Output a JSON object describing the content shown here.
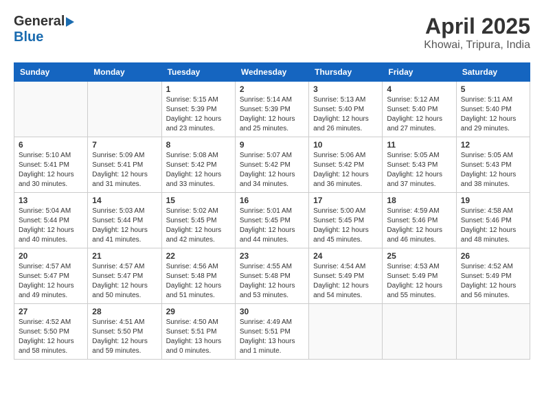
{
  "logo": {
    "general": "General",
    "blue": "Blue"
  },
  "title": "April 2025",
  "location": "Khowai, Tripura, India",
  "weekdays": [
    "Sunday",
    "Monday",
    "Tuesday",
    "Wednesday",
    "Thursday",
    "Friday",
    "Saturday"
  ],
  "days": [
    {
      "num": "",
      "sunrise": "",
      "sunset": "",
      "daylight": ""
    },
    {
      "num": "",
      "sunrise": "",
      "sunset": "",
      "daylight": ""
    },
    {
      "num": "1",
      "sunrise": "Sunrise: 5:15 AM",
      "sunset": "Sunset: 5:39 PM",
      "daylight": "Daylight: 12 hours and 23 minutes."
    },
    {
      "num": "2",
      "sunrise": "Sunrise: 5:14 AM",
      "sunset": "Sunset: 5:39 PM",
      "daylight": "Daylight: 12 hours and 25 minutes."
    },
    {
      "num": "3",
      "sunrise": "Sunrise: 5:13 AM",
      "sunset": "Sunset: 5:40 PM",
      "daylight": "Daylight: 12 hours and 26 minutes."
    },
    {
      "num": "4",
      "sunrise": "Sunrise: 5:12 AM",
      "sunset": "Sunset: 5:40 PM",
      "daylight": "Daylight: 12 hours and 27 minutes."
    },
    {
      "num": "5",
      "sunrise": "Sunrise: 5:11 AM",
      "sunset": "Sunset: 5:40 PM",
      "daylight": "Daylight: 12 hours and 29 minutes."
    },
    {
      "num": "6",
      "sunrise": "Sunrise: 5:10 AM",
      "sunset": "Sunset: 5:41 PM",
      "daylight": "Daylight: 12 hours and 30 minutes."
    },
    {
      "num": "7",
      "sunrise": "Sunrise: 5:09 AM",
      "sunset": "Sunset: 5:41 PM",
      "daylight": "Daylight: 12 hours and 31 minutes."
    },
    {
      "num": "8",
      "sunrise": "Sunrise: 5:08 AM",
      "sunset": "Sunset: 5:42 PM",
      "daylight": "Daylight: 12 hours and 33 minutes."
    },
    {
      "num": "9",
      "sunrise": "Sunrise: 5:07 AM",
      "sunset": "Sunset: 5:42 PM",
      "daylight": "Daylight: 12 hours and 34 minutes."
    },
    {
      "num": "10",
      "sunrise": "Sunrise: 5:06 AM",
      "sunset": "Sunset: 5:42 PM",
      "daylight": "Daylight: 12 hours and 36 minutes."
    },
    {
      "num": "11",
      "sunrise": "Sunrise: 5:05 AM",
      "sunset": "Sunset: 5:43 PM",
      "daylight": "Daylight: 12 hours and 37 minutes."
    },
    {
      "num": "12",
      "sunrise": "Sunrise: 5:05 AM",
      "sunset": "Sunset: 5:43 PM",
      "daylight": "Daylight: 12 hours and 38 minutes."
    },
    {
      "num": "13",
      "sunrise": "Sunrise: 5:04 AM",
      "sunset": "Sunset: 5:44 PM",
      "daylight": "Daylight: 12 hours and 40 minutes."
    },
    {
      "num": "14",
      "sunrise": "Sunrise: 5:03 AM",
      "sunset": "Sunset: 5:44 PM",
      "daylight": "Daylight: 12 hours and 41 minutes."
    },
    {
      "num": "15",
      "sunrise": "Sunrise: 5:02 AM",
      "sunset": "Sunset: 5:45 PM",
      "daylight": "Daylight: 12 hours and 42 minutes."
    },
    {
      "num": "16",
      "sunrise": "Sunrise: 5:01 AM",
      "sunset": "Sunset: 5:45 PM",
      "daylight": "Daylight: 12 hours and 44 minutes."
    },
    {
      "num": "17",
      "sunrise": "Sunrise: 5:00 AM",
      "sunset": "Sunset: 5:45 PM",
      "daylight": "Daylight: 12 hours and 45 minutes."
    },
    {
      "num": "18",
      "sunrise": "Sunrise: 4:59 AM",
      "sunset": "Sunset: 5:46 PM",
      "daylight": "Daylight: 12 hours and 46 minutes."
    },
    {
      "num": "19",
      "sunrise": "Sunrise: 4:58 AM",
      "sunset": "Sunset: 5:46 PM",
      "daylight": "Daylight: 12 hours and 48 minutes."
    },
    {
      "num": "20",
      "sunrise": "Sunrise: 4:57 AM",
      "sunset": "Sunset: 5:47 PM",
      "daylight": "Daylight: 12 hours and 49 minutes."
    },
    {
      "num": "21",
      "sunrise": "Sunrise: 4:57 AM",
      "sunset": "Sunset: 5:47 PM",
      "daylight": "Daylight: 12 hours and 50 minutes."
    },
    {
      "num": "22",
      "sunrise": "Sunrise: 4:56 AM",
      "sunset": "Sunset: 5:48 PM",
      "daylight": "Daylight: 12 hours and 51 minutes."
    },
    {
      "num": "23",
      "sunrise": "Sunrise: 4:55 AM",
      "sunset": "Sunset: 5:48 PM",
      "daylight": "Daylight: 12 hours and 53 minutes."
    },
    {
      "num": "24",
      "sunrise": "Sunrise: 4:54 AM",
      "sunset": "Sunset: 5:49 PM",
      "daylight": "Daylight: 12 hours and 54 minutes."
    },
    {
      "num": "25",
      "sunrise": "Sunrise: 4:53 AM",
      "sunset": "Sunset: 5:49 PM",
      "daylight": "Daylight: 12 hours and 55 minutes."
    },
    {
      "num": "26",
      "sunrise": "Sunrise: 4:52 AM",
      "sunset": "Sunset: 5:49 PM",
      "daylight": "Daylight: 12 hours and 56 minutes."
    },
    {
      "num": "27",
      "sunrise": "Sunrise: 4:52 AM",
      "sunset": "Sunset: 5:50 PM",
      "daylight": "Daylight: 12 hours and 58 minutes."
    },
    {
      "num": "28",
      "sunrise": "Sunrise: 4:51 AM",
      "sunset": "Sunset: 5:50 PM",
      "daylight": "Daylight: 12 hours and 59 minutes."
    },
    {
      "num": "29",
      "sunrise": "Sunrise: 4:50 AM",
      "sunset": "Sunset: 5:51 PM",
      "daylight": "Daylight: 13 hours and 0 minutes."
    },
    {
      "num": "30",
      "sunrise": "Sunrise: 4:49 AM",
      "sunset": "Sunset: 5:51 PM",
      "daylight": "Daylight: 13 hours and 1 minute."
    }
  ]
}
